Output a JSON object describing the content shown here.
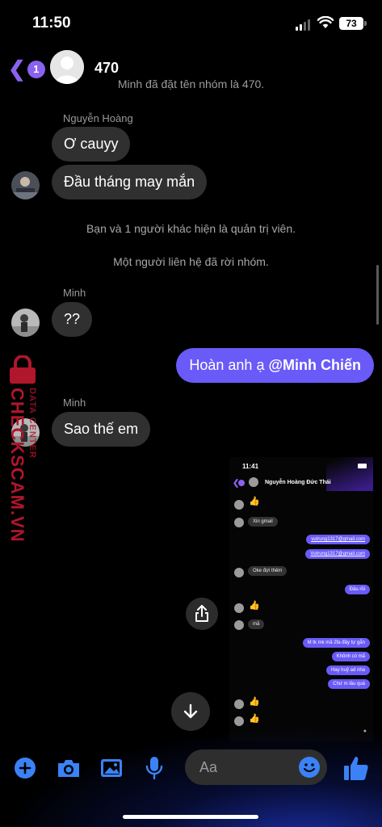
{
  "status_bar": {
    "time": "11:50",
    "battery": "73"
  },
  "header": {
    "unread_badge": "1",
    "title": "470"
  },
  "clipped_notice": "Minh đã đặt tên nhóm là 470.",
  "messages": {
    "sender_1": "Nguyễn Hoàng",
    "msg_1": "Ơ cauyy",
    "msg_2": "Đầu tháng may mắn",
    "system_1": "Bạn và 1 người khác hiện là quản trị viên.",
    "system_2": "Một người liên hệ đã rời nhóm.",
    "sender_2": "Minh",
    "msg_3": "??",
    "out_1_text": "Hoàn anh ạ ",
    "out_1_mention": "@Minh Chiến",
    "sender_3": "Minh",
    "msg_4": "Sao thế em"
  },
  "watermark": {
    "brand": "CHECKSCAM.VN",
    "sub": "DATA CENTER"
  },
  "shared_screenshot": {
    "time": "11:41",
    "title": "Nguyễn Hoàng Đức Thái",
    "in_1": "Xin gmail",
    "out_1": "vutrung1317@gmail.com",
    "out_2": "Vutrung1317@gmail.com",
    "in_2": "Oke đợi thêm",
    "out_3": "Đâu rồi",
    "in_3": "mã",
    "out_4": "M tk mk mã 2fa đây tự gắn",
    "out_5": "Khônh có mã",
    "out_6": "Hay huỷ ad nha",
    "out_7": "Chứ m lâu quá",
    "like_glyph": "👍"
  },
  "composer": {
    "placeholder": "Aa"
  },
  "colors": {
    "accent": "#6a5af8",
    "back": "#8a62f0",
    "icon_blue": "#3b82f6",
    "incoming": "#303030"
  }
}
